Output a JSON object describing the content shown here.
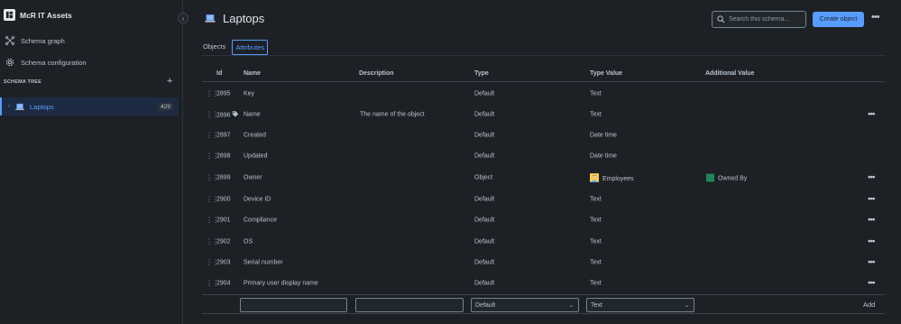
{
  "app": {
    "title": "McR IT Assets"
  },
  "sidebar": {
    "collapse_icon": "chevron-left-icon",
    "nav": [
      {
        "label": "Schema graph",
        "icon": "schema-graph-icon"
      },
      {
        "label": "Schema configuration",
        "icon": "gear-icon"
      }
    ],
    "tree_header": "SCHEMA TREE",
    "tree_add_icon": "plus-icon",
    "tree_items": [
      {
        "label": "Laptops",
        "count": "429",
        "icon": "laptop-icon",
        "selected": true
      }
    ]
  },
  "header": {
    "title": "Laptops",
    "search_placeholder": "Search this schema...",
    "create_label": "Create object",
    "more_icon": "more-icon"
  },
  "tabs": [
    {
      "label": "Objects",
      "active": false
    },
    {
      "label": "Attributes",
      "active": true
    }
  ],
  "table": {
    "columns": [
      "Id",
      "Name",
      "Description",
      "Type",
      "Type Value",
      "Additional Value"
    ],
    "rows": [
      {
        "id": "2895",
        "name": "Key",
        "description": "",
        "type": "Default",
        "type_value": "Text",
        "additional": "",
        "has_more": false,
        "label_icon": false
      },
      {
        "id": "2896",
        "name": "Name",
        "description": "The name of the object",
        "type": "Default",
        "type_value": "Text",
        "additional": "",
        "has_more": true,
        "label_icon": true
      },
      {
        "id": "2897",
        "name": "Created",
        "description": "",
        "type": "Default",
        "type_value": "Date time",
        "additional": "",
        "has_more": false,
        "label_icon": false
      },
      {
        "id": "2898",
        "name": "Updated",
        "description": "",
        "type": "Default",
        "type_value": "Date time",
        "additional": "",
        "has_more": false,
        "label_icon": false
      },
      {
        "id": "2899",
        "name": "Owner",
        "description": "",
        "type": "Object",
        "type_value": "Employees",
        "additional": "Owned By",
        "has_more": true,
        "label_icon": false,
        "type_value_icon": "employee-avatar-icon",
        "additional_color": "#1f845a"
      },
      {
        "id": "2900",
        "name": "Device ID",
        "description": "",
        "type": "Default",
        "type_value": "Text",
        "additional": "",
        "has_more": true,
        "label_icon": false
      },
      {
        "id": "2901",
        "name": "Compliance",
        "description": "",
        "type": "Default",
        "type_value": "Text",
        "additional": "",
        "has_more": true,
        "label_icon": false
      },
      {
        "id": "2902",
        "name": "OS",
        "description": "",
        "type": "Default",
        "type_value": "Text",
        "additional": "",
        "has_more": true,
        "label_icon": false
      },
      {
        "id": "2903",
        "name": "Serial number",
        "description": "",
        "type": "Default",
        "type_value": "Text",
        "additional": "",
        "has_more": true,
        "label_icon": false
      },
      {
        "id": "2904",
        "name": "Primary user display name",
        "description": "",
        "type": "Default",
        "type_value": "Text",
        "additional": "",
        "has_more": true,
        "label_icon": false
      }
    ]
  },
  "new_row": {
    "name_value": "",
    "description_value": "",
    "type_selected": "Default",
    "type_value_selected": "Text",
    "add_label": "Add"
  },
  "colors": {
    "background": "#1d2125",
    "accent": "#579dff",
    "selected_bg": "#1c2b41",
    "owned_by_swatch": "#1f845a"
  }
}
